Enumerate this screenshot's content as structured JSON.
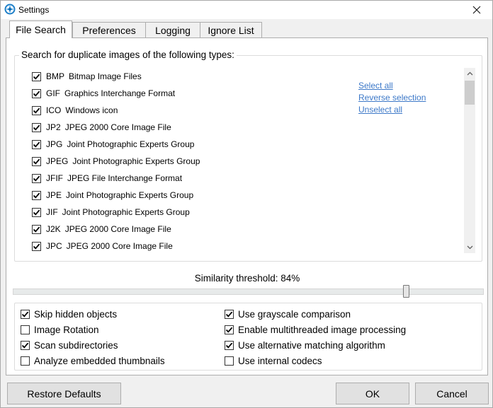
{
  "window": {
    "title": "Settings"
  },
  "tabs": [
    {
      "label": "File Search"
    },
    {
      "label": "Preferences"
    },
    {
      "label": "Logging"
    },
    {
      "label": "Ignore List"
    }
  ],
  "file_types_group": {
    "title": "Search for duplicate images of the following types:",
    "items": [
      {
        "ext": "BMP",
        "desc": "Bitmap Image Files",
        "checked": true
      },
      {
        "ext": "GIF",
        "desc": "Graphics Interchange Format",
        "checked": true
      },
      {
        "ext": "ICO",
        "desc": "Windows icon",
        "checked": true
      },
      {
        "ext": "JP2",
        "desc": "JPEG 2000 Core Image File",
        "checked": true
      },
      {
        "ext": "JPG",
        "desc": "Joint Photographic Experts Group",
        "checked": true
      },
      {
        "ext": "JPEG",
        "desc": "Joint Photographic Experts Group",
        "checked": true
      },
      {
        "ext": "JFIF",
        "desc": "JPEG File Interchange Format",
        "checked": true
      },
      {
        "ext": "JPE",
        "desc": "Joint Photographic Experts Group",
        "checked": true
      },
      {
        "ext": "JIF",
        "desc": "Joint Photographic Experts Group",
        "checked": true
      },
      {
        "ext": "J2K",
        "desc": "JPEG 2000 Core Image File",
        "checked": true
      },
      {
        "ext": "JPC",
        "desc": "JPEG 2000 Core Image File",
        "checked": true
      }
    ],
    "links": {
      "select_all": "Select all",
      "reverse": "Reverse selection",
      "unselect_all": "Unselect all"
    }
  },
  "similarity": {
    "label": "Similarity threshold: 84%",
    "value_percent": 84
  },
  "options": [
    {
      "label": "Skip hidden objects",
      "checked": true
    },
    {
      "label": "Image Rotation",
      "checked": false
    },
    {
      "label": "Scan subdirectories",
      "checked": true
    },
    {
      "label": "Analyze embedded thumbnails",
      "checked": false
    },
    {
      "label": "Use grayscale comparison",
      "checked": true
    },
    {
      "label": "Enable multithreaded image processing",
      "checked": true
    },
    {
      "label": "Use alternative matching algorithm",
      "checked": true
    },
    {
      "label": "Use internal codecs",
      "checked": false
    }
  ],
  "buttons": {
    "restore": "Restore Defaults",
    "ok": "OK",
    "cancel": "Cancel"
  },
  "colors": {
    "link": "#3c78c8",
    "accent": "#0078d7"
  }
}
